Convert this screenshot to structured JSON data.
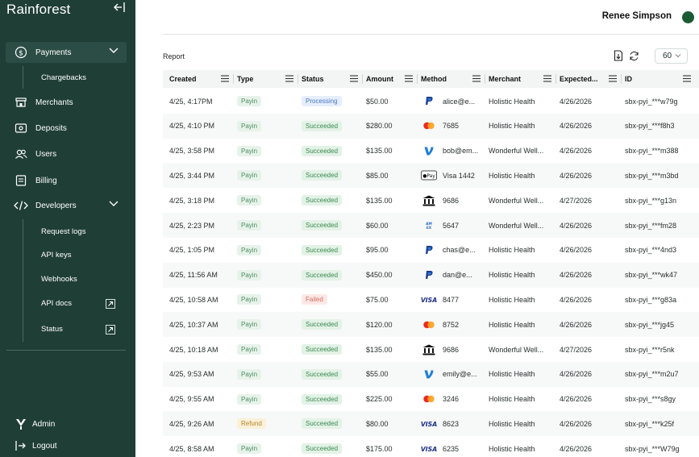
{
  "sidebar": {
    "brand": "Rainforest",
    "nav": [
      {
        "label": "Payments",
        "icon": "dollar-circle-icon"
      },
      {
        "label": "Merchants",
        "icon": "storefront-icon"
      },
      {
        "label": "Deposits",
        "icon": "deposit-icon"
      },
      {
        "label": "Users",
        "icon": "users-icon"
      },
      {
        "label": "Billing",
        "icon": "billing-icon"
      },
      {
        "label": "Developers",
        "icon": "code-icon"
      }
    ],
    "payments_sub": [
      "Chargebacks"
    ],
    "developers_sub": [
      "Request logs",
      "API keys",
      "Webhooks",
      "API docs",
      "Status"
    ],
    "footer": [
      {
        "label": "Admin",
        "icon": "rainforest-logo-icon"
      },
      {
        "label": "Logout",
        "icon": "logout-icon"
      }
    ]
  },
  "header": {
    "user_name": "Renee Simpson",
    "avatar_color": "#1b5b34"
  },
  "report": {
    "title": "Report",
    "page_size": "60"
  },
  "table": {
    "columns": [
      "Created",
      "Type",
      "Status",
      "Amount",
      "Method",
      "Merchant",
      "Expected...",
      "ID"
    ],
    "rows": [
      {
        "created": "4/25, 4:17PM",
        "type": "Payin",
        "status": "Processing",
        "amount": "$50.00",
        "method_icon": "paypal",
        "method": "alice@e...",
        "merchant": "Holistic Health",
        "expected": "4/26/2026",
        "id": "sbx-pyi_***w79g"
      },
      {
        "created": "4/25, 4:10 PM",
        "type": "Payin",
        "status": "Succeeded",
        "amount": "$280.00",
        "method_icon": "mastercard",
        "method": "7685",
        "merchant": "Holistic Health",
        "expected": "4/26/2026",
        "id": "sbx-pyi_***f8h3"
      },
      {
        "created": "4/25, 3:58 PM",
        "type": "Payin",
        "status": "Succeeded",
        "amount": "$135.00",
        "method_icon": "venmo",
        "method": "bob@em...",
        "merchant": "Wonderful Well...",
        "expected": "4/26/2026",
        "id": "sbx-pyi_***m388"
      },
      {
        "created": "4/25, 3:44 PM",
        "type": "Payin",
        "status": "Succeeded",
        "amount": "$85.00",
        "method_icon": "applepay",
        "method": "Visa 1442",
        "merchant": "Holistic Health",
        "expected": "4/26/2026",
        "id": "sbx-pyi_***m3bd"
      },
      {
        "created": "4/25, 3:18 PM",
        "type": "Payin",
        "status": "Succeeded",
        "amount": "$135.00",
        "method_icon": "bank",
        "method": "9686",
        "merchant": "Wonderful Well...",
        "expected": "4/27/2026",
        "id": "sbx-pyi_***g13n"
      },
      {
        "created": "4/25, 2:23 PM",
        "type": "Payin",
        "status": "Succeeded",
        "amount": "$60.00",
        "method_icon": "amex",
        "method": "5647",
        "merchant": "Wonderful Well...",
        "expected": "4/26/2026",
        "id": "sbx-pyi_***fm28"
      },
      {
        "created": "4/25, 1:05 PM",
        "type": "Payin",
        "status": "Succeeded",
        "amount": "$95.00",
        "method_icon": "paypal",
        "method": "chas@e...",
        "merchant": "Holistic Health",
        "expected": "4/26/2026",
        "id": "sbx-pyi_***4nd3"
      },
      {
        "created": "4/25, 11:56 AM",
        "type": "Payin",
        "status": "Succeeded",
        "amount": "$450.00",
        "method_icon": "paypal",
        "method": "dan@e...",
        "merchant": "Holistic Health",
        "expected": "4/26/2026",
        "id": "sbx-pyi_***wk47"
      },
      {
        "created": "4/25, 10:58 AM",
        "type": "Payin",
        "status": "Failed",
        "amount": "$75.00",
        "method_icon": "visa",
        "method": "8477",
        "merchant": "Holistic Health",
        "expected": "4/26/2026",
        "id": "sbx-pyi_***g83a"
      },
      {
        "created": "4/25, 10:37 AM",
        "type": "Payin",
        "status": "Succeeded",
        "amount": "$120.00",
        "method_icon": "mastercard",
        "method": "8752",
        "merchant": "Holistic Health",
        "expected": "4/26/2026",
        "id": "sbx-pyi_***jg45"
      },
      {
        "created": "4/25, 10:18 AM",
        "type": "Payin",
        "status": "Succeeded",
        "amount": "$135.00",
        "method_icon": "bank",
        "method": "9686",
        "merchant": "Wonderful Well...",
        "expected": "4/27/2026",
        "id": "sbx-pyi_***r5nk"
      },
      {
        "created": "4/25, 9:53 AM",
        "type": "Payin",
        "status": "Succeeded",
        "amount": "$55.00",
        "method_icon": "venmo",
        "method": "emily@e...",
        "merchant": "Holistic Health",
        "expected": "4/26/2026",
        "id": "sbx-pyi_***m2u7"
      },
      {
        "created": "4/25, 9:55 AM",
        "type": "Payin",
        "status": "Succeeded",
        "amount": "$225.00",
        "method_icon": "mastercard",
        "method": "3246",
        "merchant": "Holistic Health",
        "expected": "4/26/2026",
        "id": "sbx-pyi_***s8gy"
      },
      {
        "created": "4/25, 9:26 AM",
        "type": "Refund",
        "status": "Succeeded",
        "amount": "$80.00",
        "method_icon": "visa",
        "method": "8623",
        "merchant": "Holistic Health",
        "expected": "4/26/2026",
        "id": "sbx-pyi_***k25f"
      },
      {
        "created": "4/25, 8:58 AM",
        "type": "Payin",
        "status": "Succeeded",
        "amount": "$175.00",
        "method_icon": "visa",
        "method": "6235",
        "merchant": "Holistic Health",
        "expected": "4/26/2026",
        "id": "sbx-pyi_***W79g"
      }
    ]
  }
}
